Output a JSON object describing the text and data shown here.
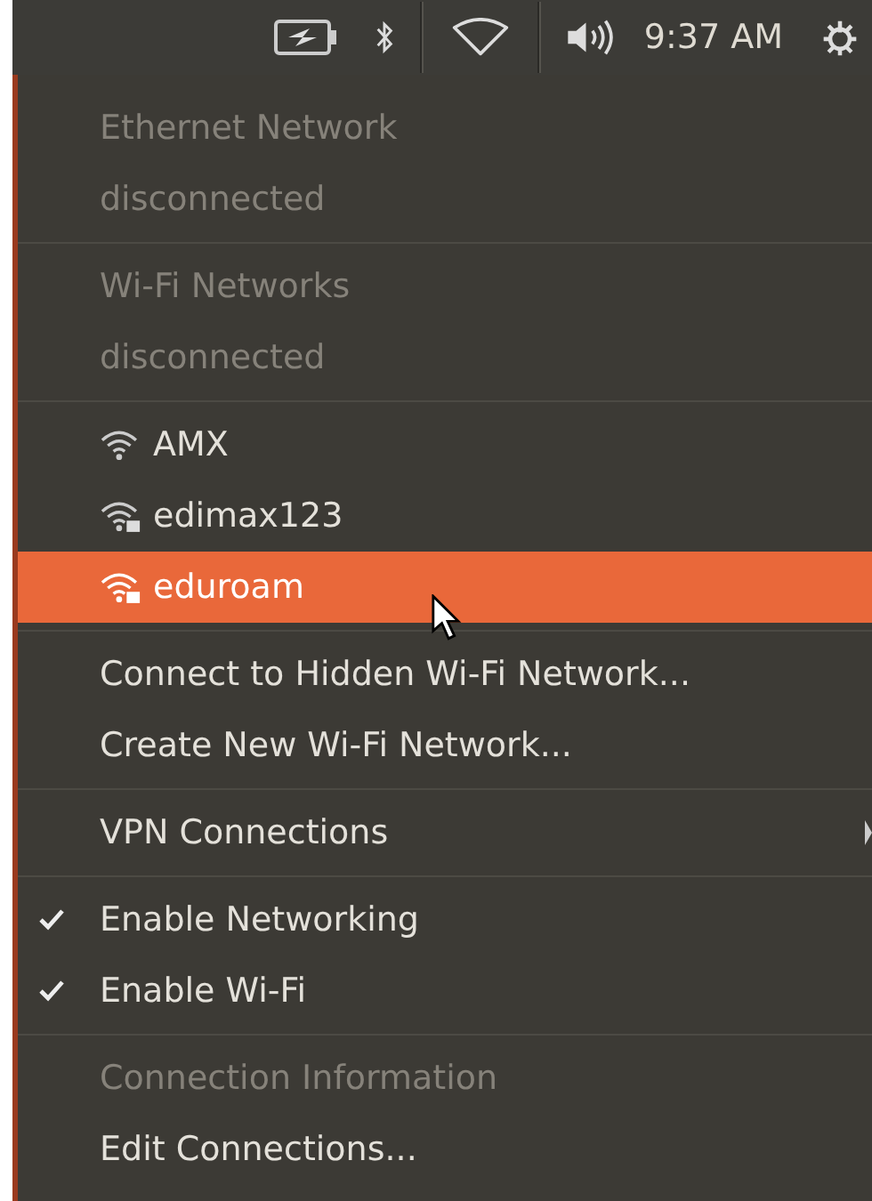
{
  "panel": {
    "time": "9:37 AM"
  },
  "menu": {
    "sections": [
      [
        {
          "kind": "header",
          "label": "Ethernet Network"
        },
        {
          "kind": "header",
          "label": "disconnected"
        }
      ],
      [
        {
          "kind": "header",
          "label": "Wi-Fi Networks"
        },
        {
          "kind": "header",
          "label": "disconnected"
        }
      ],
      [
        {
          "kind": "network",
          "label": "AMX",
          "secured": false,
          "selected": false
        },
        {
          "kind": "network",
          "label": "edimax123",
          "secured": true,
          "selected": false
        },
        {
          "kind": "network",
          "label": "eduroam",
          "secured": true,
          "selected": true
        }
      ],
      [
        {
          "kind": "action",
          "label": "Connect to Hidden Wi-Fi Network..."
        },
        {
          "kind": "action",
          "label": "Create New Wi-Fi Network..."
        }
      ],
      [
        {
          "kind": "submenu",
          "label": "VPN Connections"
        }
      ],
      [
        {
          "kind": "check",
          "label": "Enable Networking",
          "checked": true
        },
        {
          "kind": "check",
          "label": "Enable Wi-Fi",
          "checked": true
        }
      ],
      [
        {
          "kind": "header",
          "label": "Connection Information"
        },
        {
          "kind": "action",
          "label": "Edit Connections..."
        }
      ]
    ]
  }
}
